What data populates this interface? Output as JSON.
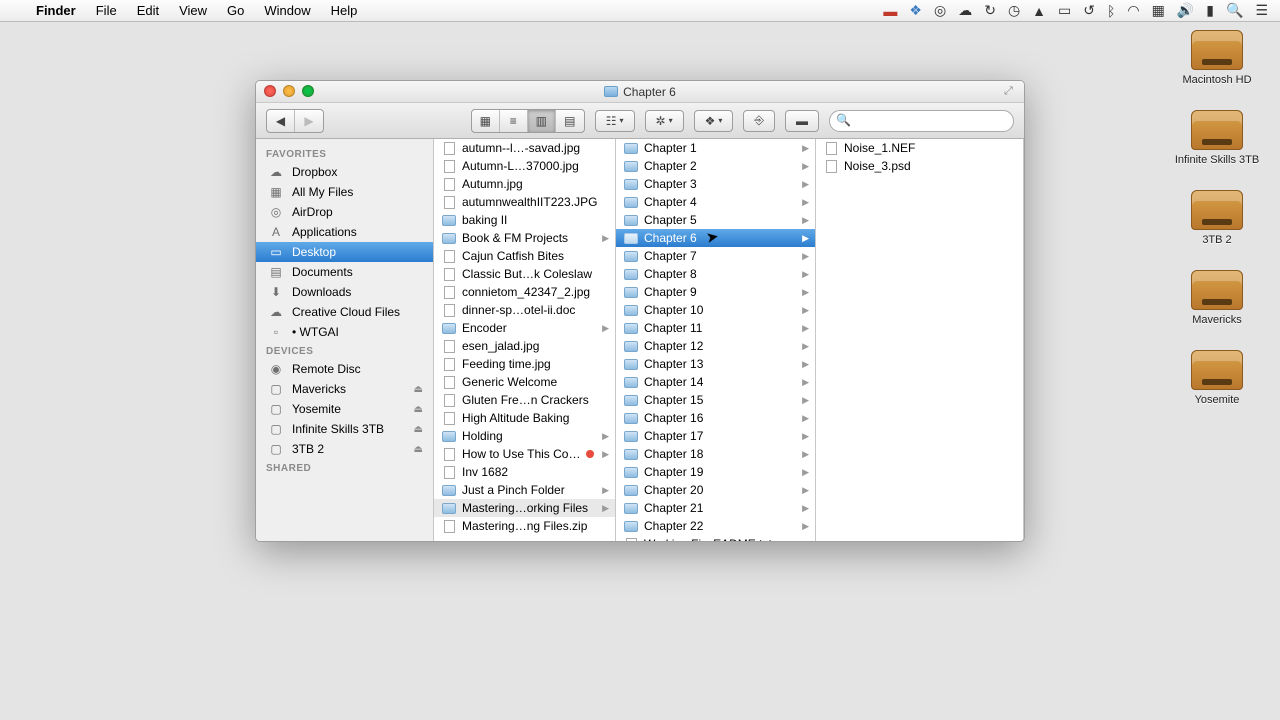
{
  "menubar": {
    "app": "Finder",
    "items": [
      "File",
      "Edit",
      "View",
      "Go",
      "Window",
      "Help"
    ]
  },
  "desktop": [
    {
      "label": "Macintosh HD"
    },
    {
      "label": "Infinite Skills 3TB"
    },
    {
      "label": "3TB 2"
    },
    {
      "label": "Mavericks"
    },
    {
      "label": "Yosemite"
    }
  ],
  "window": {
    "title": "Chapter 6",
    "search_placeholder": ""
  },
  "sidebar": {
    "favorites_header": "FAVORITES",
    "favorites": [
      {
        "label": "Dropbox",
        "icon": "☁"
      },
      {
        "label": "All My Files",
        "icon": "▦"
      },
      {
        "label": "AirDrop",
        "icon": "◎"
      },
      {
        "label": "Applications",
        "icon": "A"
      },
      {
        "label": "Desktop",
        "icon": "▭",
        "selected": true
      },
      {
        "label": "Documents",
        "icon": "▤"
      },
      {
        "label": "Downloads",
        "icon": "⬇"
      },
      {
        "label": "Creative Cloud Files",
        "icon": "☁"
      },
      {
        "label": "• WTGAI",
        "icon": "▫"
      }
    ],
    "devices_header": "DEVICES",
    "devices": [
      {
        "label": "Remote Disc",
        "icon": "◉"
      },
      {
        "label": "Mavericks",
        "icon": "▢",
        "eject": true
      },
      {
        "label": "Yosemite",
        "icon": "▢",
        "eject": true
      },
      {
        "label": "Infinite Skills 3TB",
        "icon": "▢",
        "eject": true
      },
      {
        "label": "3TB 2",
        "icon": "▢",
        "eject": true
      }
    ],
    "shared_header": "SHARED"
  },
  "col1": [
    {
      "label": "autumn--l…-savad.jpg",
      "type": "file"
    },
    {
      "label": "Autumn-L…37000.jpg",
      "type": "file"
    },
    {
      "label": "Autumn.jpg",
      "type": "file"
    },
    {
      "label": "autumnwealthIIT223.JPG",
      "type": "file"
    },
    {
      "label": "baking II",
      "type": "folder"
    },
    {
      "label": "Book & FM Projects",
      "type": "folder",
      "chev": true
    },
    {
      "label": "Cajun Catfish Bites",
      "type": "file"
    },
    {
      "label": "Classic But…k Coleslaw",
      "type": "file"
    },
    {
      "label": "connietom_42347_2.jpg",
      "type": "file"
    },
    {
      "label": "dinner-sp…otel-ii.doc",
      "type": "file"
    },
    {
      "label": "Encoder",
      "type": "folder",
      "chev": true
    },
    {
      "label": "esen_jalad.jpg",
      "type": "file"
    },
    {
      "label": "Feeding time.jpg",
      "type": "file"
    },
    {
      "label": "Generic Welcome",
      "type": "file"
    },
    {
      "label": "Gluten Fre…n Crackers",
      "type": "file"
    },
    {
      "label": "High Altitude Baking",
      "type": "file"
    },
    {
      "label": "Holding",
      "type": "folder",
      "chev": true
    },
    {
      "label": "How to Use This Course",
      "type": "file",
      "tag": "red",
      "chev": true
    },
    {
      "label": "Inv 1682",
      "type": "file"
    },
    {
      "label": "Just a Pinch Folder",
      "type": "folder",
      "chev": true
    },
    {
      "label": "Mastering…orking Files",
      "type": "folder",
      "chev": true,
      "dim": true
    },
    {
      "label": "Mastering…ng Files.zip",
      "type": "file"
    }
  ],
  "col2": [
    {
      "label": "Chapter 1",
      "type": "folder",
      "chev": true
    },
    {
      "label": "Chapter 2",
      "type": "folder",
      "chev": true
    },
    {
      "label": "Chapter 3",
      "type": "folder",
      "chev": true
    },
    {
      "label": "Chapter 4",
      "type": "folder",
      "chev": true
    },
    {
      "label": "Chapter 5",
      "type": "folder",
      "chev": true
    },
    {
      "label": "Chapter 6",
      "type": "folder",
      "chev": true,
      "selected": true
    },
    {
      "label": "Chapter 7",
      "type": "folder",
      "chev": true
    },
    {
      "label": "Chapter 8",
      "type": "folder",
      "chev": true
    },
    {
      "label": "Chapter 9",
      "type": "folder",
      "chev": true
    },
    {
      "label": "Chapter 10",
      "type": "folder",
      "chev": true
    },
    {
      "label": "Chapter 11",
      "type": "folder",
      "chev": true
    },
    {
      "label": "Chapter 12",
      "type": "folder",
      "chev": true
    },
    {
      "label": "Chapter 13",
      "type": "folder",
      "chev": true
    },
    {
      "label": "Chapter 14",
      "type": "folder",
      "chev": true
    },
    {
      "label": "Chapter 15",
      "type": "folder",
      "chev": true
    },
    {
      "label": "Chapter 16",
      "type": "folder",
      "chev": true
    },
    {
      "label": "Chapter 17",
      "type": "folder",
      "chev": true
    },
    {
      "label": "Chapter 18",
      "type": "folder",
      "chev": true
    },
    {
      "label": "Chapter 19",
      "type": "folder",
      "chev": true
    },
    {
      "label": "Chapter 20",
      "type": "folder",
      "chev": true
    },
    {
      "label": "Chapter 21",
      "type": "folder",
      "chev": true
    },
    {
      "label": "Chapter 22",
      "type": "folder",
      "chev": true
    },
    {
      "label": "Working Fi…EADME.txt",
      "type": "file"
    }
  ],
  "col3": [
    {
      "label": "Noise_1.NEF",
      "type": "file"
    },
    {
      "label": "Noise_3.psd",
      "type": "file"
    }
  ]
}
